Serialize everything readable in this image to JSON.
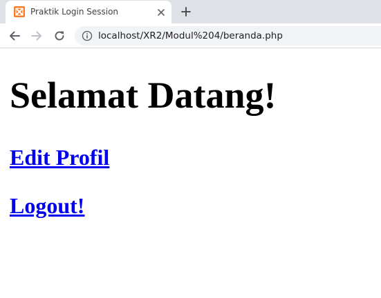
{
  "browser": {
    "tab_title": "Praktik Login Session",
    "favicon": "xampp-icon",
    "url": "localhost/XR2/Modul%204/beranda.php",
    "colors": {
      "tabstrip": "#dee1e6",
      "favicon": "#fb7a24",
      "omnibox": "#f1f3f4"
    }
  },
  "page": {
    "heading": "Selamat Datang!",
    "links": [
      {
        "label": "Edit Profil"
      },
      {
        "label": "Logout!"
      }
    ],
    "colors": {
      "link": "#0000ee",
      "text": "#000000"
    }
  }
}
